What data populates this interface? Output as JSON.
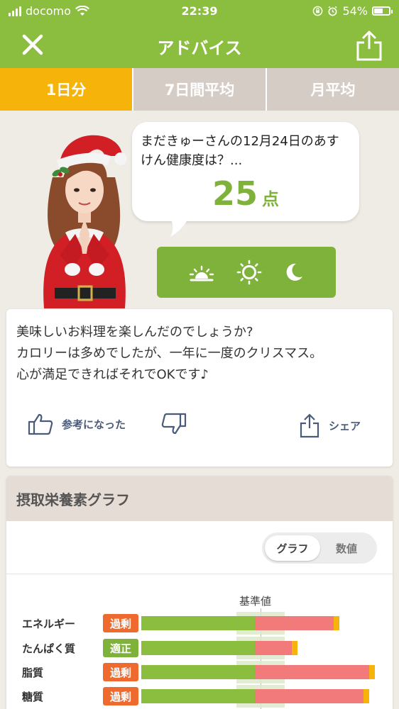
{
  "status": {
    "carrier": "docomo",
    "time": "22:39",
    "battery": "54%",
    "battery_level": 0.54
  },
  "nav": {
    "title": "アドバイス",
    "close_icon": "close-icon",
    "share_icon": "share-icon"
  },
  "tabs": [
    {
      "label": "1日分",
      "active": true
    },
    {
      "label": "7日間平均",
      "active": false
    },
    {
      "label": "月平均",
      "active": false
    }
  ],
  "bubble": {
    "question": "まだきゅーさんの12月24日のあすけん健康度は？...",
    "score": "25",
    "unit": "点"
  },
  "time_of_day": [
    "sunrise-icon",
    "sun-icon",
    "moon-icon"
  ],
  "advice": {
    "lines": [
      "美味しいお料理を楽しんだのでしょうか?",
      "カロリーは多めでしたが、一年に一度のクリスマス。",
      "心が満足できればそれでOKです♪"
    ],
    "helpful_label": "参考になった",
    "share_label": "シェア"
  },
  "nutrition": {
    "title": "摂取栄養素グラフ",
    "toggle": {
      "graph": "グラフ",
      "values": "数値"
    },
    "ref_label": "基準値",
    "rows": [
      {
        "name": "エネルギー",
        "status": "過剰",
        "status_color": "#ef6a2e",
        "value_pct": 166
      },
      {
        "name": "たんぱく質",
        "status": "適正",
        "status_color": "#7fb23a",
        "value_pct": 131
      },
      {
        "name": "脂質",
        "status": "過剰",
        "status_color": "#ef6a2e",
        "value_pct": 196
      },
      {
        "name": "糖質",
        "status": "過剰",
        "status_color": "#ef6a2e",
        "value_pct": 191
      }
    ]
  },
  "colors": {
    "brand": "#8bbd3f",
    "tab_active": "#f6b30a",
    "score": "#7fb23a",
    "over": "#ef6a2e"
  }
}
